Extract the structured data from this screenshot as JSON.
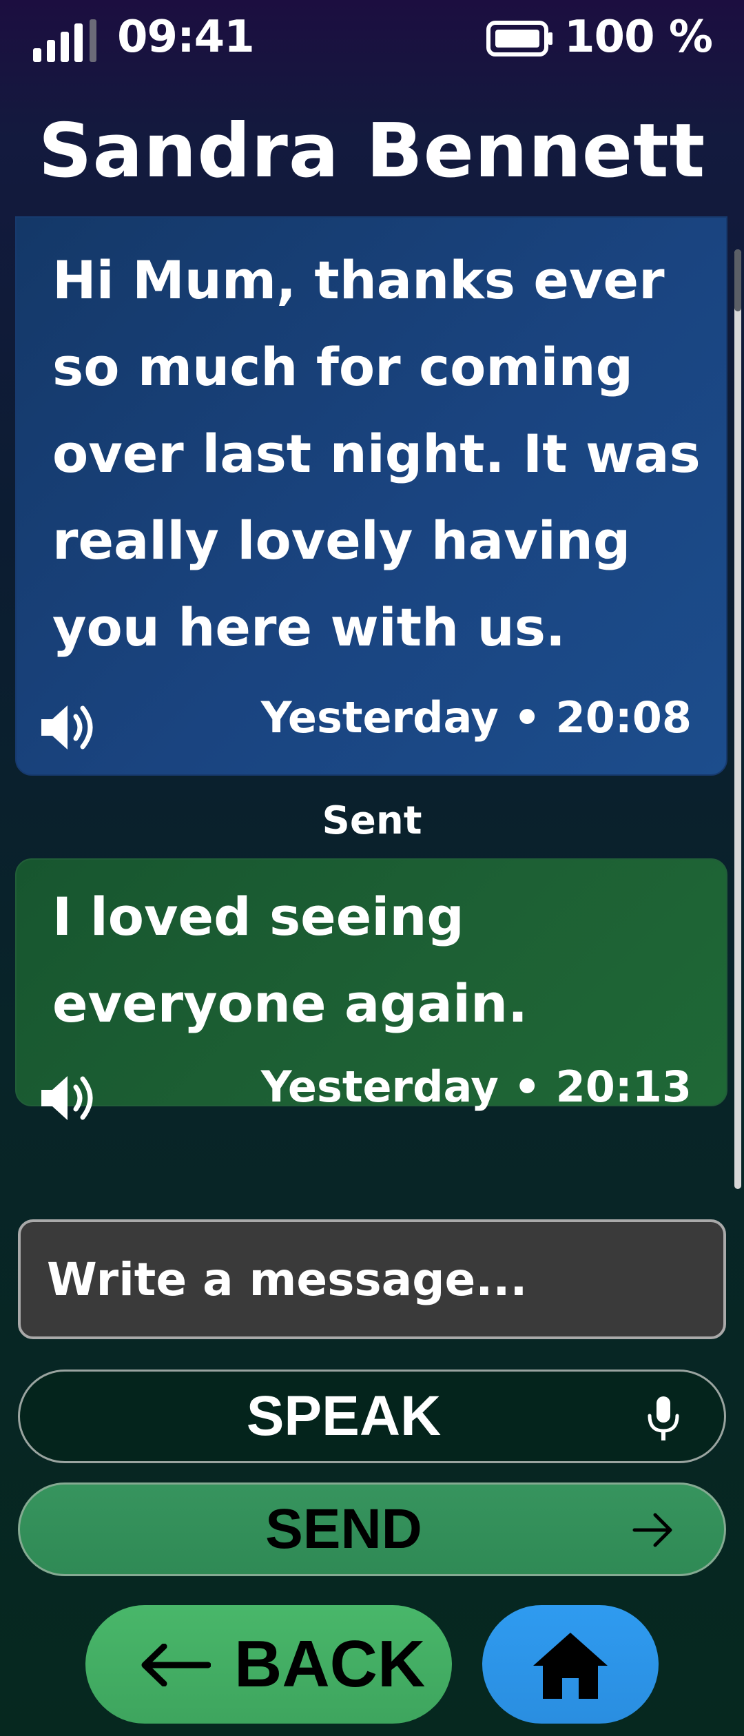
{
  "status_bar": {
    "time": "09:41",
    "battery": "100 %",
    "signal_icon": "signal-bars-icon",
    "battery_icon": "battery-full-icon"
  },
  "header": {
    "contact_name": "Sandra Bennett"
  },
  "messages": [
    {
      "direction": "received",
      "text": "Hi Mum, thanks ever so much for coming over last night. It was really lovely having you here with us.",
      "timestamp": "Yesterday • 20:08",
      "icon": "speaker-icon",
      "color": "#1a4480"
    },
    {
      "direction": "sent",
      "status": "Sent",
      "text": "I loved seeing everyone again.",
      "timestamp": "Yesterday • 20:13",
      "icon": "speaker-icon",
      "color": "#1d6034"
    }
  ],
  "composer": {
    "placeholder": "Write a message..."
  },
  "actions": {
    "speak_label": "SPEAK",
    "speak_icon": "microphone-icon",
    "send_label": "SEND",
    "send_icon": "arrow-right-icon"
  },
  "nav": {
    "back_label": "BACK",
    "back_icon": "arrow-left-icon",
    "home_icon": "home-icon",
    "back_color": "#49b76a",
    "home_color": "#2f9bf0"
  }
}
